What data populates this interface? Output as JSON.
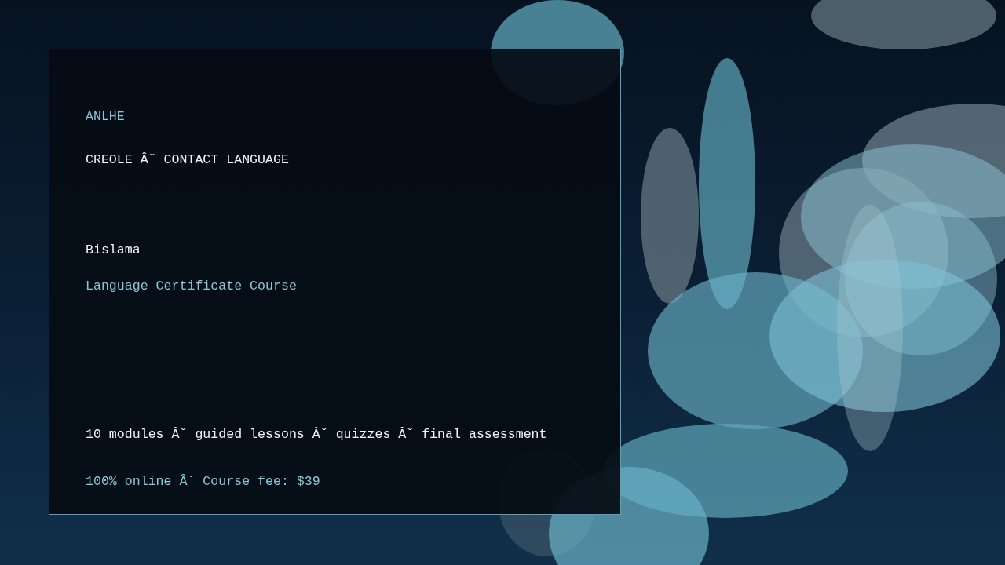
{
  "brand": "ANLHE",
  "category": "CREOLE Âˇ CONTACT LANGUAGE",
  "title": "Bislama",
  "subtitle": "Language Certificate Course",
  "details": "10 modules Âˇ guided lessons Âˇ quizzes Âˇ final assessment",
  "pricing": "100% online Âˇ Course fee: $39"
}
